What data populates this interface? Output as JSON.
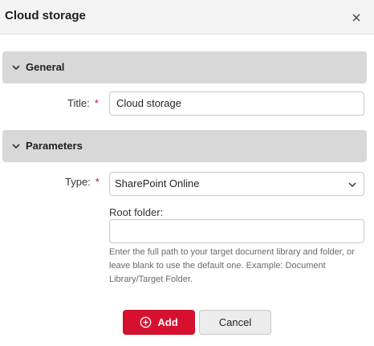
{
  "dialog": {
    "title": "Cloud storage",
    "close_icon": "close-icon"
  },
  "sections": {
    "general": {
      "label": "General",
      "icon": "chevron-down-icon"
    },
    "parameters": {
      "label": "Parameters",
      "icon": "chevron-down-icon"
    }
  },
  "fields": {
    "title": {
      "label": "Title:",
      "required_mark": "*",
      "value": "Cloud storage"
    },
    "type": {
      "label": "Type:",
      "required_mark": "*",
      "selected": "SharePoint Online"
    },
    "root_folder": {
      "label": "Root folder:",
      "value": "",
      "help": "Enter the full path to your target document library and folder, or leave blank to use the default one. Example: Document Library/Target Folder."
    }
  },
  "buttons": {
    "add": {
      "label": "Add",
      "icon": "plus-circle-icon"
    },
    "cancel": {
      "label": "Cancel"
    }
  },
  "colors": {
    "accent": "#d8102f",
    "required": "#c4122f",
    "section_bg": "#d8d8d8"
  }
}
